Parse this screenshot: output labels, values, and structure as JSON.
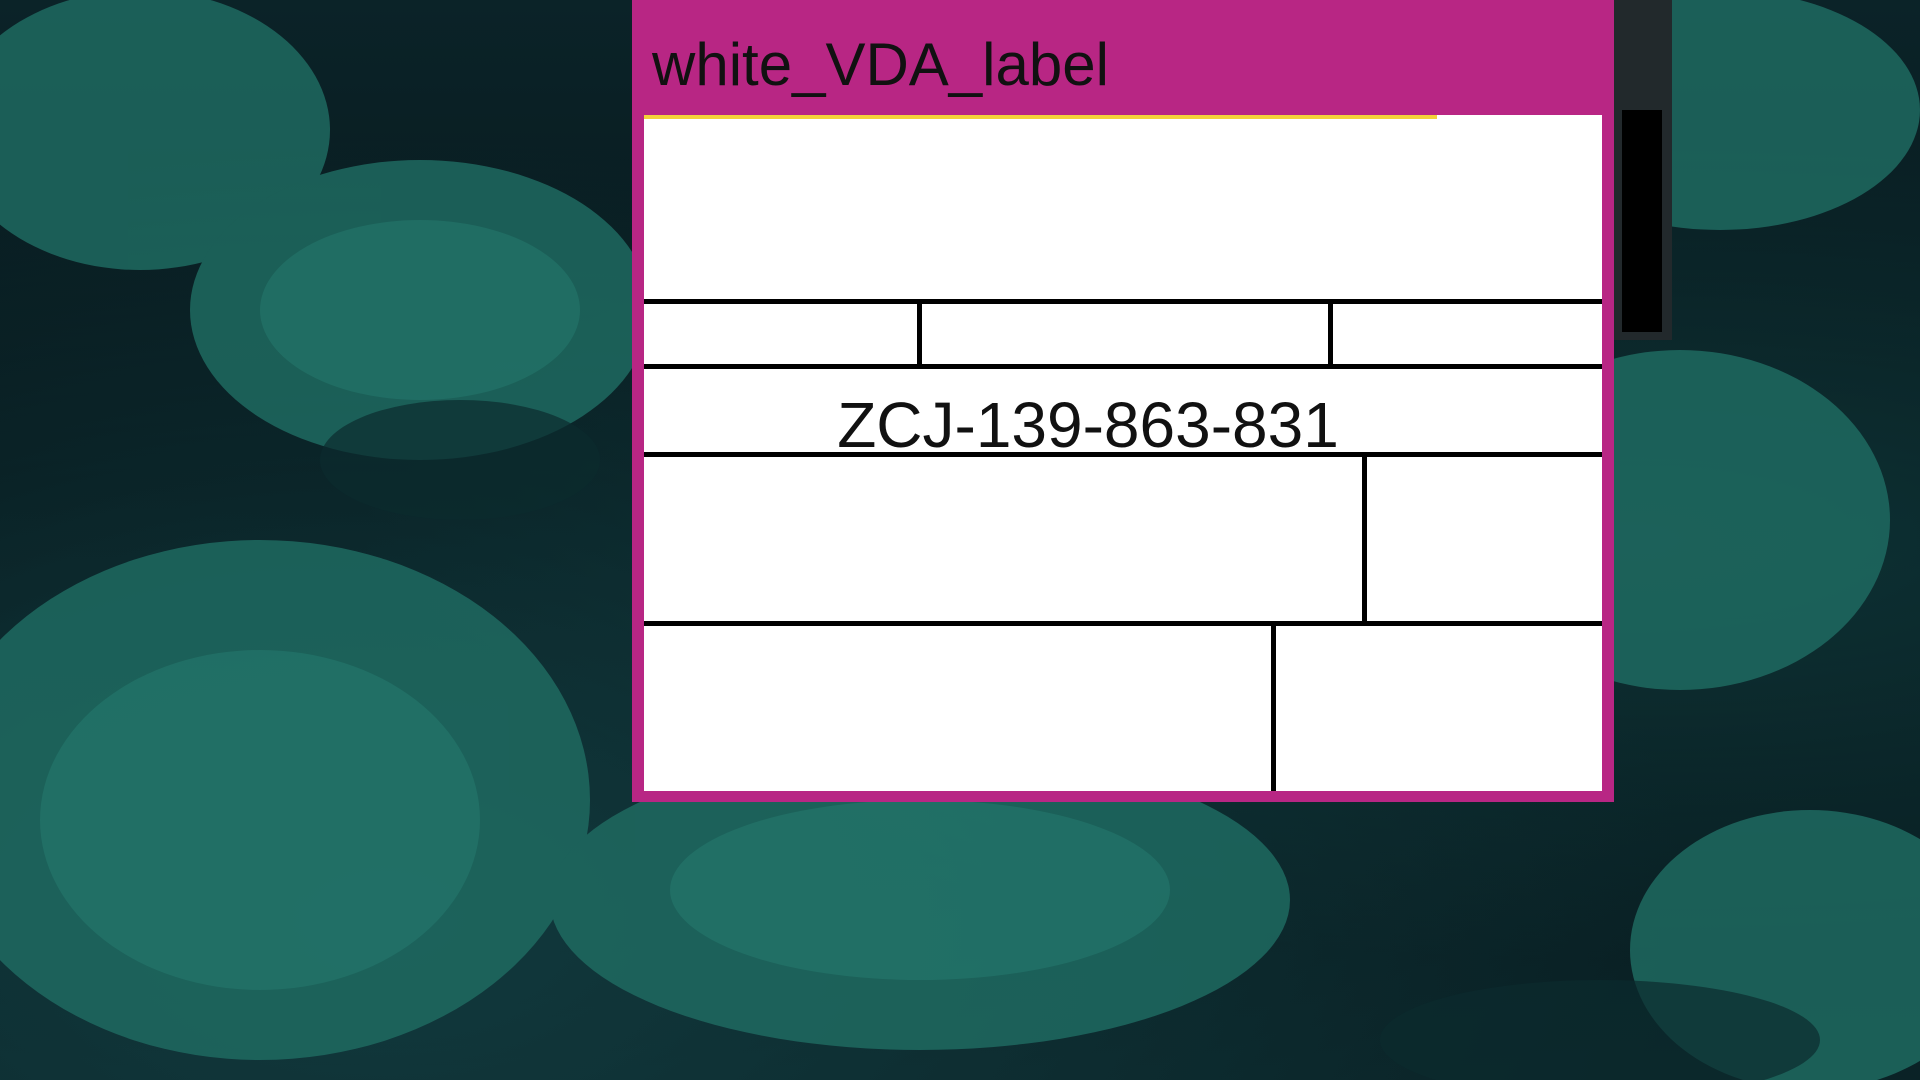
{
  "window": {
    "title": "white_VDA_label",
    "accent_color": "#b82684"
  },
  "label": {
    "id_number": "ZCJ-139-863-831"
  },
  "desktop": {
    "wallpaper": "water-lily-leaves"
  }
}
